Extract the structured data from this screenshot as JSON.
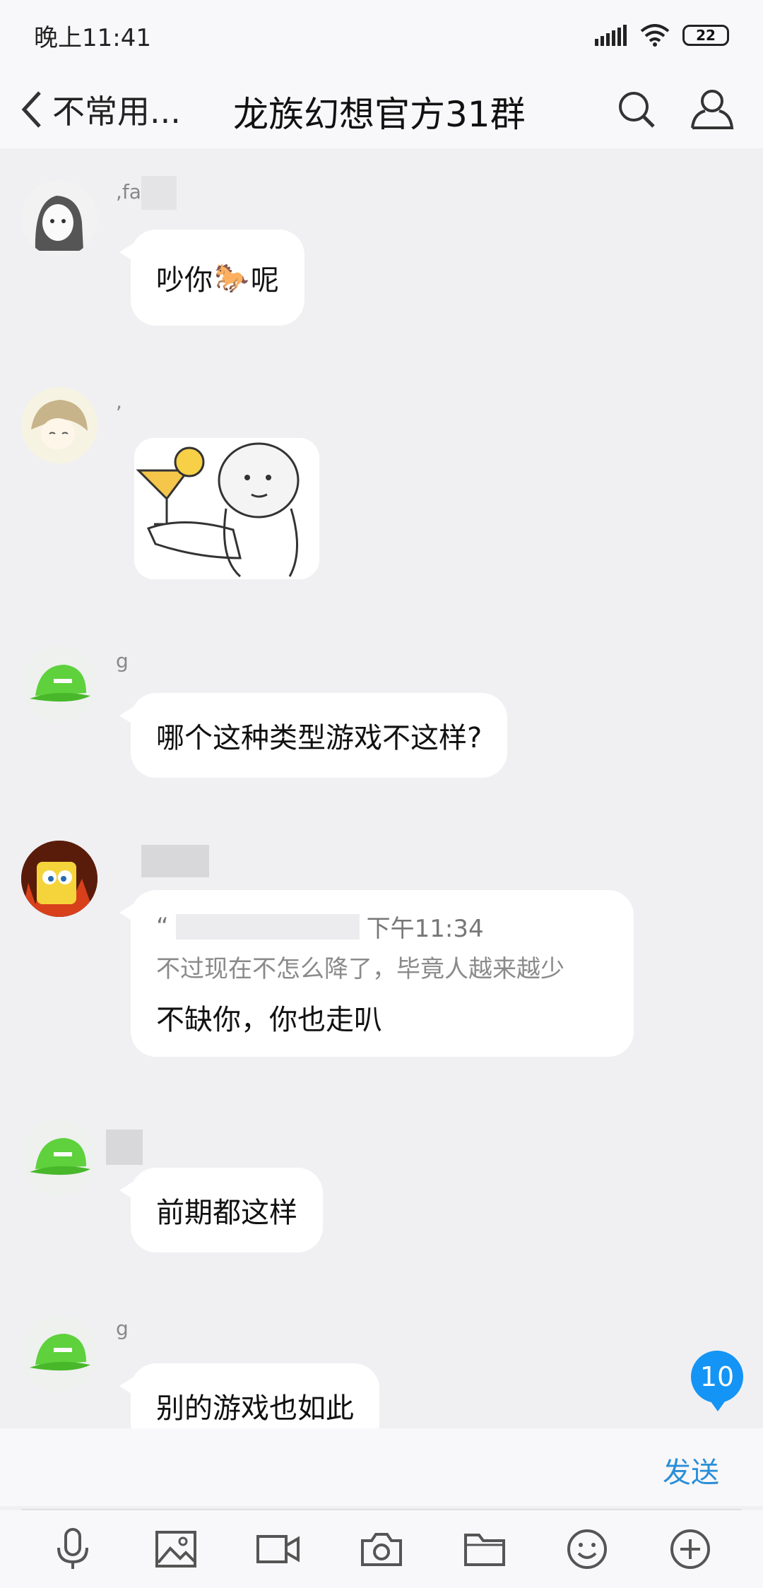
{
  "status_bar": {
    "time": "晚上11:41",
    "battery": "22"
  },
  "header": {
    "back_label": "不常用...",
    "title": "龙族幻想官方31群"
  },
  "messages": [
    {
      "sender": ",fa",
      "text_before": "吵你",
      "emoji": "🐎",
      "text_after": "呢"
    },
    {
      "sender": ",",
      "type": "sticker"
    },
    {
      "sender": "g",
      "text": "哪个这种类型游戏不这样?"
    },
    {
      "sender": "",
      "quote_open": "“",
      "quote_time": "下午11:34",
      "quote_text": "不过现在不怎么降了，毕竟人越来越少",
      "text": "不缺你，你也走叭"
    },
    {
      "sender": "",
      "text": "前期都这样"
    },
    {
      "sender": "g",
      "text": "别的游戏也如此"
    }
  ],
  "unread_badge": "10",
  "input": {
    "placeholder": "",
    "send_label": "发送"
  },
  "toolbar_icons": [
    "microphone-icon",
    "image-icon",
    "video-icon",
    "camera-icon",
    "folder-icon",
    "emoji-icon",
    "plus-icon"
  ]
}
